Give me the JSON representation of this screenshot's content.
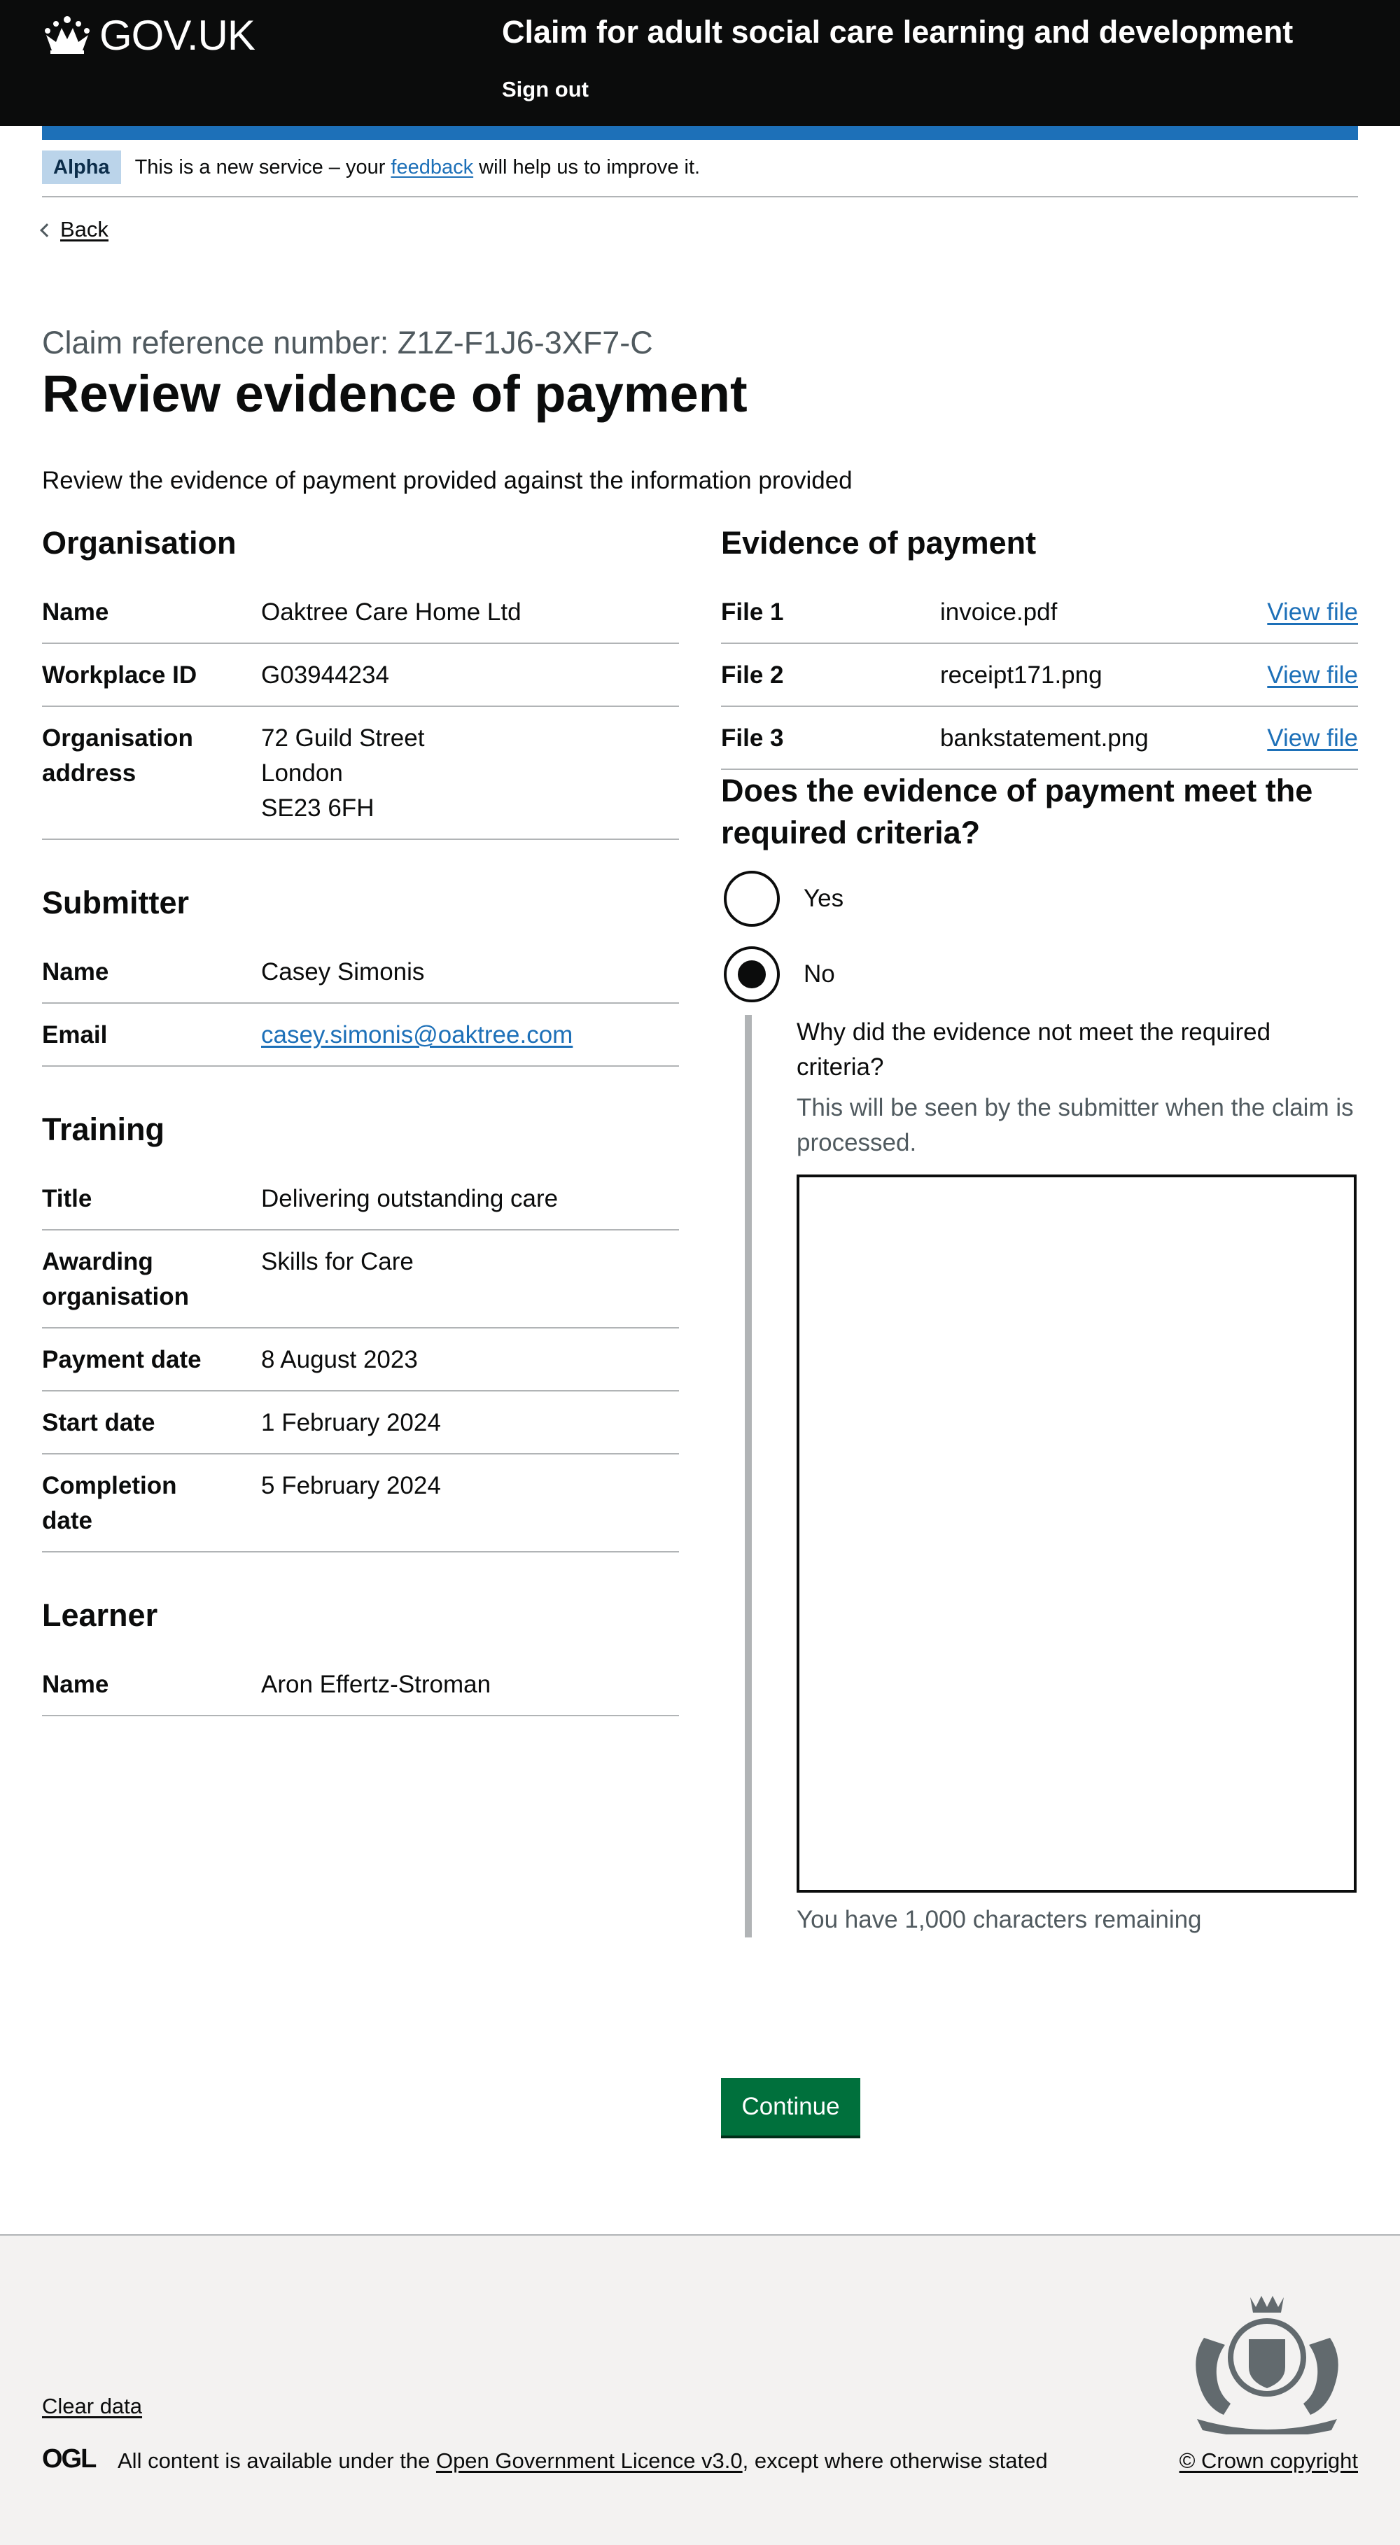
{
  "header": {
    "logo_text": "GOV.UK",
    "service_name": "Claim for adult social care learning and development",
    "sign_out": "Sign out"
  },
  "phase_banner": {
    "tag": "Alpha",
    "text_before": "This is a new service – your ",
    "link": "feedback",
    "text_after": " will help us to improve it."
  },
  "back_link": "Back",
  "caption": "Claim reference number: Z1Z-F1J6-3XF7-C",
  "title": "Review evidence of payment",
  "lead": "Review the evidence of payment provided against the information provided",
  "organisation": {
    "heading": "Organisation",
    "rows": [
      {
        "key": "Name",
        "value": "Oaktree Care Home Ltd"
      },
      {
        "key": "Workplace ID",
        "value": "G03944234"
      },
      {
        "key": "Organisation address",
        "line1": "72 Guild Street",
        "line2": "London",
        "line3": "SE23 6FH"
      }
    ]
  },
  "submitter": {
    "heading": "Submitter",
    "rows": [
      {
        "key": "Name",
        "value": "Casey Simonis"
      },
      {
        "key": "Email",
        "value": "casey.simonis@oaktree.com"
      }
    ]
  },
  "training": {
    "heading": "Training",
    "rows": [
      {
        "key": "Title",
        "value": "Delivering outstanding care"
      },
      {
        "key": "Awarding organisation",
        "value": "Skills for Care"
      },
      {
        "key": "Payment date",
        "value": "8 August 2023"
      },
      {
        "key": "Start date",
        "value": "1 February 2024"
      },
      {
        "key": "Completion date",
        "value": "5 February 2024"
      }
    ]
  },
  "learner": {
    "heading": "Learner",
    "rows": [
      {
        "key": "Name",
        "value": "Aron Effertz-Stroman"
      }
    ]
  },
  "evidence": {
    "heading": "Evidence of payment",
    "files": [
      {
        "key": "File 1",
        "value": "invoice.pdf",
        "action": "View file"
      },
      {
        "key": "File 2",
        "value": "receipt171.png",
        "action": "View file"
      },
      {
        "key": "File 3",
        "value": "bankstatement.png",
        "action": "View file"
      }
    ]
  },
  "criteria": {
    "question": "Does the evidence of payment meet the required criteria?",
    "yes_label": "Yes",
    "no_label": "No",
    "selected": "No",
    "reason_label": "Why did the evidence not meet the required criteria?",
    "reason_hint": "This will be seen by the submitter when the claim is processed.",
    "reason_value": "",
    "character_count": "You have 1,000 characters remaining"
  },
  "continue_button": "Continue",
  "footer": {
    "clear_data": "Clear data",
    "ogl_logo": "OGL",
    "licence_before": "All content is available under the ",
    "licence_link": "Open Government Licence v3.0",
    "licence_after": ", except where otherwise stated",
    "crown_copyright": "© Crown copyright"
  },
  "colors": {
    "header_bg": "#0b0c0c",
    "brand_blue": "#1d70b8",
    "button_green": "#00703c",
    "footer_bg": "#f3f2f1"
  }
}
